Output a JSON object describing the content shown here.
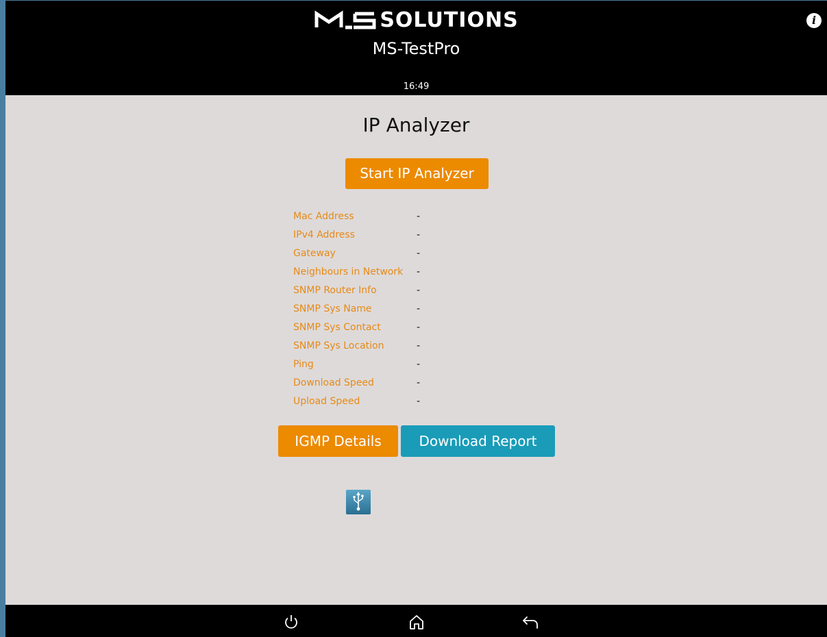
{
  "header": {
    "logo_text": "SOLUTIONS",
    "product_name": "MS-TestPro",
    "time": "16:49",
    "info_icon": "info-icon"
  },
  "main": {
    "title": "IP Analyzer",
    "start_button_label": "Start IP Analyzer",
    "info_rows": [
      {
        "label": "Mac Address",
        "value": "-"
      },
      {
        "label": "IPv4 Address",
        "value": "-"
      },
      {
        "label": "Gateway",
        "value": "-"
      },
      {
        "label": "Neighbours in Network",
        "value": "-"
      },
      {
        "label": "SNMP Router Info",
        "value": "-"
      },
      {
        "label": "SNMP Sys Name",
        "value": "-"
      },
      {
        "label": "SNMP Sys Contact",
        "value": "-"
      },
      {
        "label": "SNMP Sys Location",
        "value": "-"
      },
      {
        "label": "Ping",
        "value": "-"
      },
      {
        "label": "Download Speed",
        "value": "-"
      },
      {
        "label": "Upload Speed",
        "value": "-"
      }
    ],
    "igmp_button_label": "IGMP Details",
    "report_button_label": "Download Report"
  },
  "footer": {
    "icons": [
      "power-icon",
      "usb-icon",
      "home-icon",
      "back-icon"
    ]
  },
  "colors": {
    "accent_orange": "#ec8a00",
    "accent_teal": "#1a9cb8",
    "label_orange": "#e68a16",
    "background": "#dedada",
    "bar": "#000000"
  }
}
